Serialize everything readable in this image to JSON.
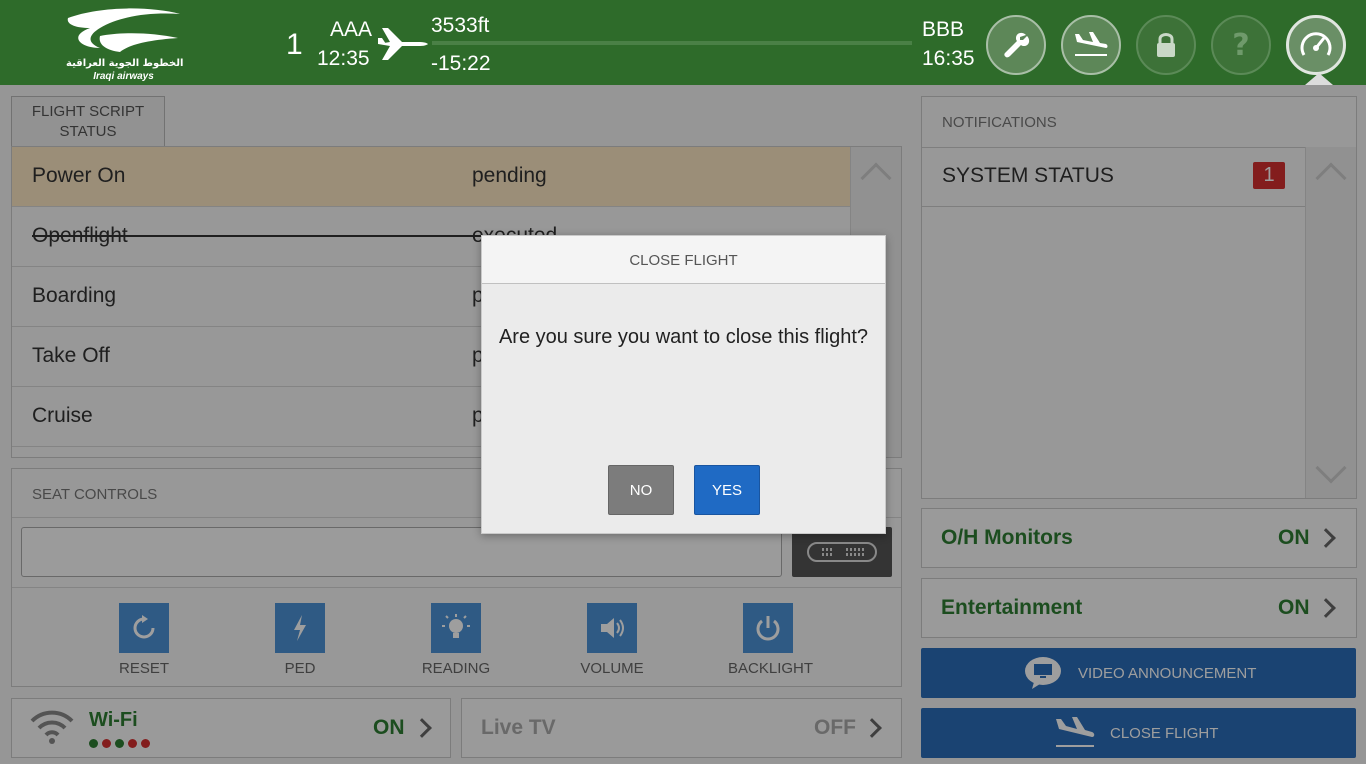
{
  "header": {
    "logo_arabic": "الخطوط الجوية العراقية",
    "logo_english": "Iraqi airways",
    "flight_number": "1",
    "origin_code": "AAA",
    "origin_time": "12:35",
    "altitude": "3533ft",
    "time_remaining": "-15:22",
    "destination_code": "BBB",
    "destination_time": "16:35",
    "buttons": [
      "wrench-icon",
      "landing-plane-icon",
      "lock-icon",
      "help-icon",
      "dashboard-gauge-icon"
    ]
  },
  "flight_script": {
    "tab_label": "FLIGHT SCRIPT\nSTATUS",
    "rows": [
      {
        "name": "Power On",
        "status": "pending"
      },
      {
        "name": "Openflight",
        "status": "executed"
      },
      {
        "name": "Boarding",
        "status": "p"
      },
      {
        "name": "Take Off",
        "status": "p"
      },
      {
        "name": "Cruise",
        "status": "p"
      }
    ]
  },
  "seat_controls": {
    "title": "SEAT CONTROLS",
    "input_value": "",
    "controls": [
      {
        "label": "RESET",
        "icon": "reset-icon"
      },
      {
        "label": "PED",
        "icon": "lightning-icon"
      },
      {
        "label": "READING",
        "icon": "bulb-icon"
      },
      {
        "label": "VOLUME",
        "icon": "speaker-icon"
      },
      {
        "label": "BACKLIGHT",
        "icon": "power-icon"
      }
    ]
  },
  "wifi": {
    "label": "Wi-Fi",
    "status": "ON"
  },
  "live_tv": {
    "label": "Live TV",
    "status": "OFF"
  },
  "notifications": {
    "title": "NOTIFICATIONS",
    "items": [
      {
        "label": "SYSTEM STATUS",
        "count": "1"
      }
    ]
  },
  "toggles": [
    {
      "label": "O/H Monitors",
      "status": "ON"
    },
    {
      "label": "Entertainment",
      "status": "ON"
    }
  ],
  "actions": {
    "video_announcement": "VIDEO ANNOUNCEMENT",
    "close_flight": "CLOSE FLIGHT"
  },
  "modal": {
    "title": "CLOSE FLIGHT",
    "message": "Are you sure you want to close this flight?",
    "no_label": "NO",
    "yes_label": "YES"
  },
  "colors": {
    "header_green": "#2e6b2a",
    "status_green": "#2e7d32",
    "action_blue": "#2b6cb8",
    "badge_red": "#d32f2f",
    "pending_highlight": "#fbe5c2"
  }
}
